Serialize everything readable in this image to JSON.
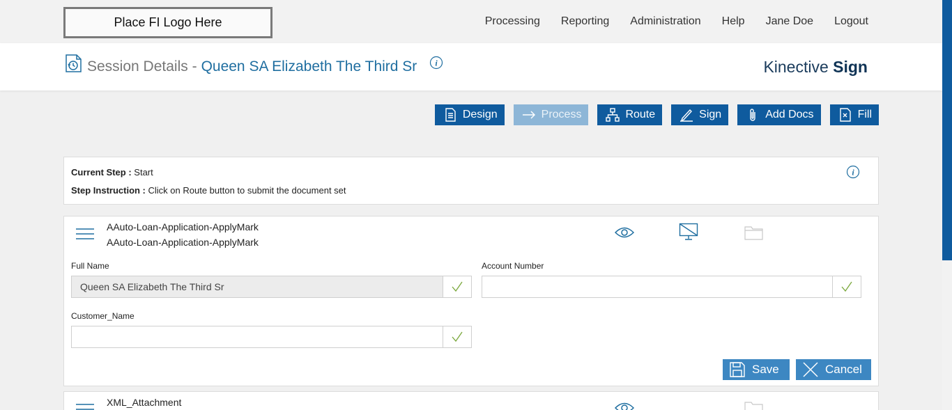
{
  "logo": {
    "text": "Place FI Logo Here"
  },
  "nav": {
    "items": [
      "Processing",
      "Reporting",
      "Administration",
      "Help",
      "Jane Doe",
      "Logout"
    ]
  },
  "session": {
    "title": "Session Details -",
    "name": "Queen SA Elizabeth The Third Sr"
  },
  "brand": {
    "prefix": "Kinective",
    "bold": "Sign"
  },
  "toolbar": {
    "design": "Design",
    "process": "Process",
    "route": "Route",
    "sign": "Sign",
    "add_docs": "Add Docs",
    "fill": "Fill"
  },
  "step": {
    "current_label": "Current Step :",
    "current_value": "Start",
    "instruction_label": "Step Instruction :",
    "instruction_value": "Click on Route button to submit the document set"
  },
  "document": {
    "name_line1": "AAuto-Loan-Application-ApplyMark",
    "name_line2": "AAuto-Loan-Application-ApplyMark",
    "fields": {
      "full_name_label": "Full Name",
      "full_name_value": "Queen SA Elizabeth The Third Sr",
      "account_number_label": "Account Number",
      "account_number_value": "",
      "customer_name_label": "Customer_Name",
      "customer_name_value": ""
    },
    "save_label": "Save",
    "cancel_label": "Cancel"
  },
  "document2": {
    "name": "XML_Attachment"
  },
  "colors": {
    "primary": "#0f5b9e",
    "primary_disabled": "#8db6d7",
    "action": "#3d87c2",
    "check": "#7aa83c",
    "accent_text": "#1f6ea0"
  }
}
